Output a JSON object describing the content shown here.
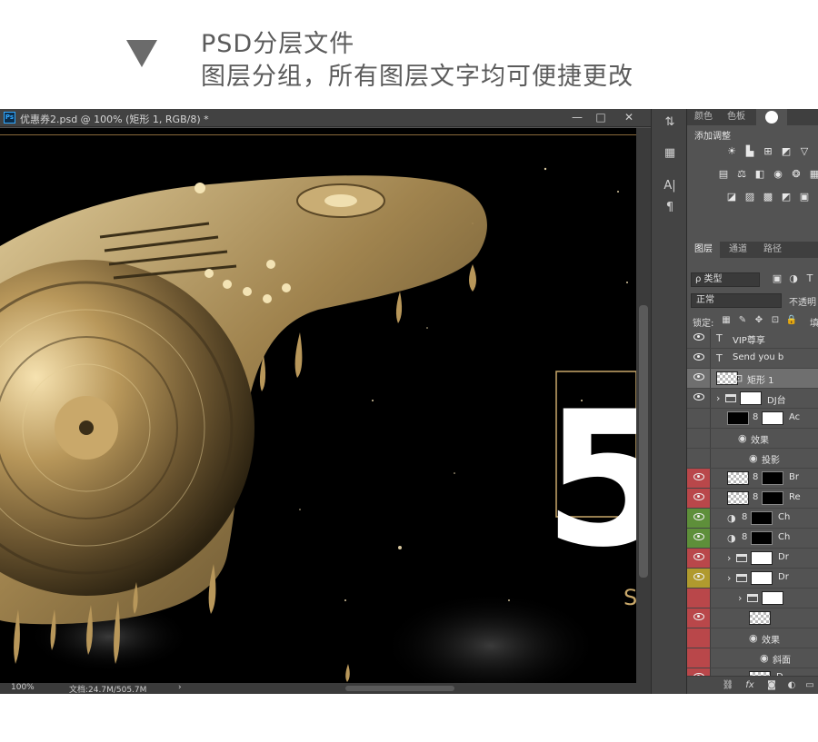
{
  "caption": {
    "line1": "PSD分层文件",
    "line2": "图层分组，所有图层文字均可便捷更改"
  },
  "document": {
    "title": "优惠券2.psd @ 100% (矩形 1, RGB/8) *",
    "ps_logo": "Ps",
    "window_buttons": {
      "minimize": "—",
      "maximize": "□",
      "close": "✕"
    },
    "canvas_number": "5",
    "canvas_letter": "S"
  },
  "status_bar": {
    "zoom": "100%",
    "doc_size": "文档:24.7M/505.7M",
    "arrow": "›"
  },
  "tools": [
    "char-para-tool",
    "swatch-tool",
    "text-A-tool",
    "paragraph-tool"
  ],
  "top_panel": {
    "tabs": [
      "颜色",
      "色板"
    ],
    "adjust_title": "添加调整"
  },
  "layers_panel": {
    "tabs": [
      "图层",
      "通道",
      "路径"
    ],
    "filter_label": "ρ 类型",
    "blend_mode": "正常",
    "opacity_label": "不透明",
    "lock_label": "锁定:",
    "fill_label": "填",
    "layers": [
      {
        "name": "VIP尊享",
        "kind": "text",
        "eye": true,
        "color": "#535353",
        "indent": 0
      },
      {
        "name": "Send you b",
        "kind": "text",
        "eye": true,
        "color": "#535353",
        "indent": 0
      },
      {
        "name": "矩形 1",
        "kind": "shape",
        "eye": true,
        "color": "#6f6f6f",
        "indent": 0,
        "selected": true
      },
      {
        "name": "DJ台",
        "kind": "group",
        "eye": true,
        "color": "#535353",
        "indent": 0
      },
      {
        "name": "Ac",
        "kind": "smart",
        "eye": false,
        "color": "#535353",
        "indent": 1
      },
      {
        "name": "效果",
        "kind": "fx",
        "eye": false,
        "color": "#535353",
        "indent": 2
      },
      {
        "name": "投影",
        "kind": "fx",
        "eye": false,
        "color": "#535353",
        "indent": 3
      },
      {
        "name": "Br",
        "kind": "masked",
        "eye": true,
        "color": "#b9474a",
        "indent": 1
      },
      {
        "name": "Re",
        "kind": "masked",
        "eye": true,
        "color": "#b9474a",
        "indent": 1
      },
      {
        "name": "Ch",
        "kind": "adjust",
        "eye": true,
        "color": "#5e8f3a",
        "indent": 1
      },
      {
        "name": "Ch",
        "kind": "adjust",
        "eye": true,
        "color": "#5e8f3a",
        "indent": 1
      },
      {
        "name": "Dr",
        "kind": "group",
        "eye": true,
        "color": "#b9474a",
        "indent": 1
      },
      {
        "name": "Dr",
        "kind": "group",
        "eye": true,
        "color": "#b09a2e",
        "indent": 1
      },
      {
        "name": "",
        "kind": "group",
        "eye": false,
        "color": "#b9474a",
        "indent": 2
      },
      {
        "name": "",
        "kind": "pixel",
        "eye": true,
        "color": "#b9474a",
        "indent": 3
      },
      {
        "name": "效果",
        "kind": "fx",
        "eye": false,
        "color": "#b9474a",
        "indent": 3
      },
      {
        "name": "斜面",
        "kind": "fx",
        "eye": false,
        "color": "#b9474a",
        "indent": 4
      },
      {
        "name": "D",
        "kind": "pixel",
        "eye": true,
        "color": "#b9474a",
        "indent": 3
      }
    ],
    "bottom_icons": [
      "link-icon",
      "fx-icon",
      "mask-icon",
      "adjustment-icon",
      "folder-icon"
    ]
  },
  "colors": {
    "gold": "#c9a86a",
    "canvas_bg": "#000000",
    "ps_bg": "#535353",
    "label_red": "#b9474a",
    "label_green": "#5e8f3a",
    "label_yellow": "#b09a2e"
  }
}
